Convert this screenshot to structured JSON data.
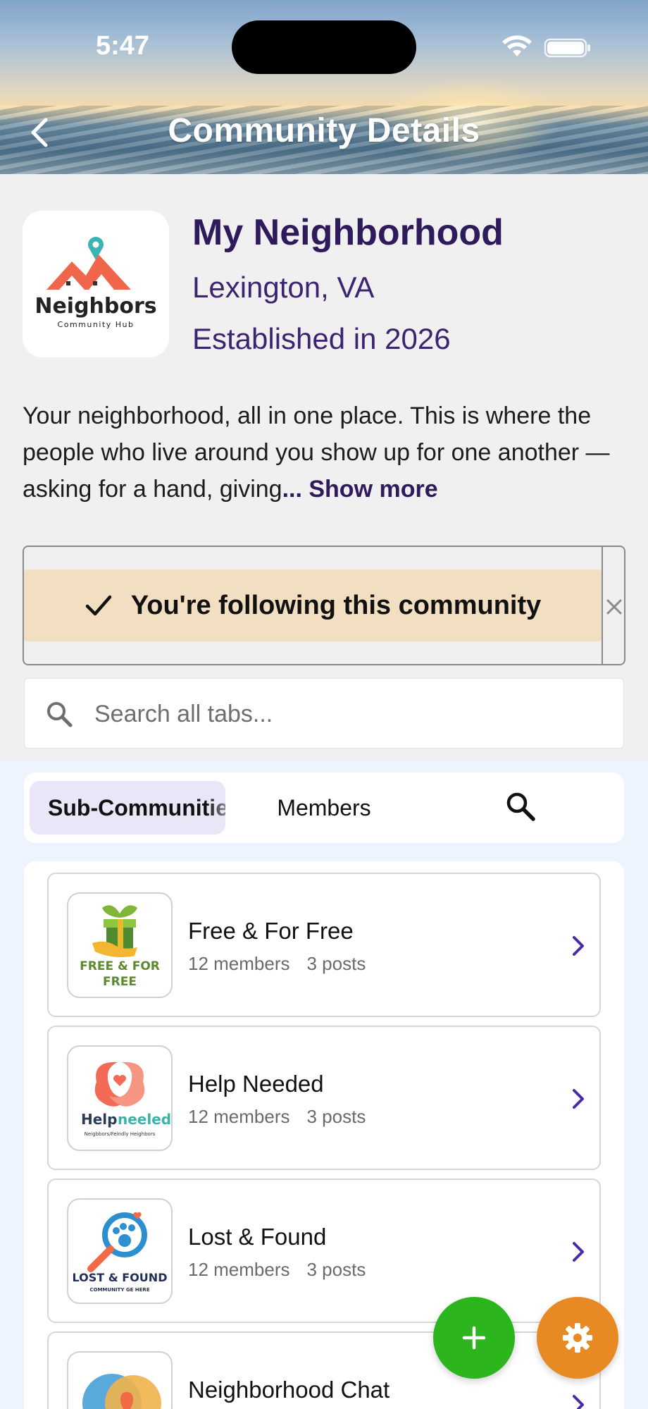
{
  "status_bar": {
    "time": "5:47"
  },
  "header": {
    "title": "Community Details",
    "back_icon": "chevron-left-icon"
  },
  "community": {
    "name": "My Neighborhood",
    "location": "Lexington, VA",
    "established": "Established in 2026",
    "logo_title": "Neighbors",
    "logo_subtitle": "Community Hub",
    "description": "Your neighborhood, all in one place. This is where the people who live around you show up for one another — asking for a hand, giving",
    "show_more": "... Show more"
  },
  "follow_banner": {
    "text": "You're following this community",
    "icon": "check-icon",
    "close_icon": "close-icon"
  },
  "search": {
    "placeholder": "Search all tabs..."
  },
  "tabs": [
    {
      "label": "Sub-Communities",
      "active": true
    },
    {
      "label": "Members",
      "active": false
    }
  ],
  "sub_communities": [
    {
      "title": "Free & For Free",
      "members": "12 members",
      "posts": "3 posts",
      "logo_text": "FREE & FOR FREE"
    },
    {
      "title": "Help Needed",
      "members": "12 members",
      "posts": "3 posts",
      "logo_text_a": "Help",
      "logo_text_b": "neeled",
      "logo_sub": "Neigbbors/Feindly Heighbors"
    },
    {
      "title": "Lost & Found",
      "members": "12 members",
      "posts": "3 posts",
      "logo_text": "LOST & FOUND",
      "logo_sub": "COMMUNITY GE HERE"
    },
    {
      "title": "Neighborhood Chat",
      "members": "",
      "posts": ""
    }
  ],
  "fabs": {
    "add_icon": "plus-icon",
    "settings_icon": "gear-icon"
  },
  "colors": {
    "primary_text": "#2f1a5c",
    "banner": "#f2dfc1",
    "add_fab": "#2db51d",
    "settings_fab": "#e88a23",
    "chevron": "#4b2aa6"
  }
}
